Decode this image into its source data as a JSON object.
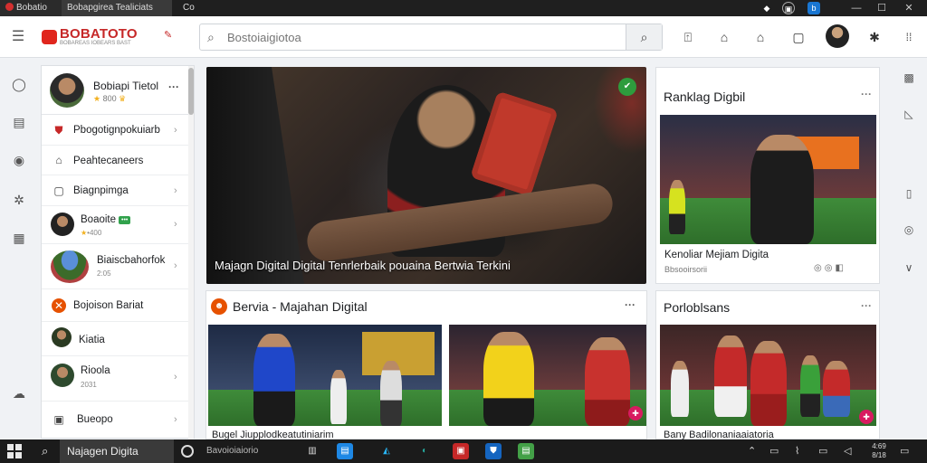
{
  "titlebar": {
    "tab1_label": "Bobatio",
    "tab2_label": "Bobapgirea Tealiciats",
    "tab3_label": "Co"
  },
  "header": {
    "brand": "BOBATOTO",
    "brand_tagline": "BOBAREAS IOBEARS BAST",
    "search_placeholder": "Bostoiaigiotoa"
  },
  "sidebar": {
    "profile": {
      "name": "Bobiapi Tietol",
      "meta": "800"
    },
    "items": [
      {
        "label": "Pbogotignpokuiarb"
      },
      {
        "label": "Peahtecaneers"
      },
      {
        "label": "Biagnpimga"
      },
      {
        "label": "Boaoite",
        "badge": "•••",
        "sub": "•400"
      },
      {
        "label": "Biaiscbahorfok",
        "sub": "2:05"
      },
      {
        "label": "Bojoison Bariat"
      },
      {
        "label": "Kiatia"
      },
      {
        "label": "Rioola",
        "sub": "2031"
      },
      {
        "label": "Bueopo"
      }
    ]
  },
  "hero": {
    "caption": "Majagn Digital Digital Tenrlerbaik pouaina Bertwia Terkini"
  },
  "news": {
    "title": "Bervia - Majahan Digital",
    "items": [
      {
        "caption": "Bugel Jiupplodkeatutiniarim"
      },
      {
        "caption": ""
      }
    ]
  },
  "right1": {
    "title": "Ranklag Digbil",
    "subtitle": "Kenoliar Mejiam Digita",
    "meta": "Bbsooirsorii"
  },
  "right2": {
    "title": "Porloblsans",
    "caption": "Bany Badilonaniaaiatoria"
  },
  "taskbar": {
    "search_value": "Najagen Digita",
    "pinned_text": "Bavoioiaiorio",
    "clock_time": "4:69",
    "clock_date": "8/18"
  },
  "colors": {
    "brand_red": "#c62828",
    "online_green": "#31a24c",
    "pin_pink": "#d81b60"
  }
}
